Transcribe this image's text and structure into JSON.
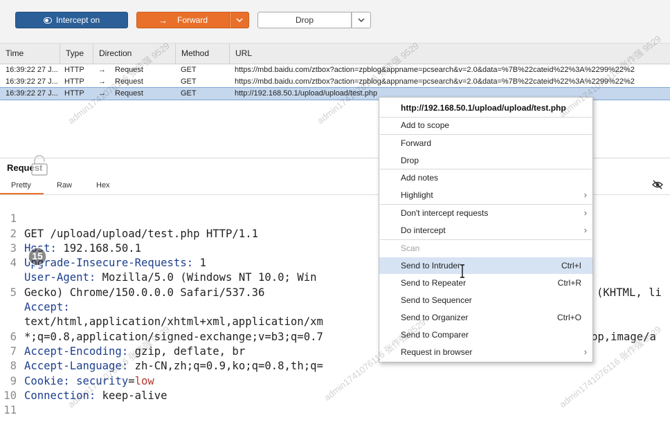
{
  "toolbar": {
    "intercept_label": "Intercept on",
    "forward_label": "Forward",
    "drop_label": "Drop"
  },
  "table": {
    "columns": [
      "Time",
      "Type",
      "Direction",
      "Method",
      "URL"
    ],
    "rows": [
      {
        "time": "16:39:22 27 J...",
        "type": "HTTP",
        "direction": "Request",
        "method": "GET",
        "url": "https://mbd.baidu.com/ztbox?action=zpblog&appname=pcsearch&v=2.0&data=%7B%22cateid%22%3A%2299%22%2"
      },
      {
        "time": "16:39:22 27 J...",
        "type": "HTTP",
        "direction": "Request",
        "method": "GET",
        "url": "https://mbd.baidu.com/ztbox?action=zpblog&appname=pcsearch&v=2.0&data=%7B%22cateid%22%3A%2299%22%2"
      },
      {
        "time": "16:39:22 27 J...",
        "type": "HTTP",
        "direction": "Request",
        "method": "GET",
        "url": "http://192.168.50.1/upload/upload/test.php"
      }
    ]
  },
  "request_panel": {
    "title": "Request",
    "tabs": [
      "Pretty",
      "Raw",
      "Hex"
    ],
    "lines": [
      {
        "n": "1",
        "key": "",
        "val": "GET /upload/upload/test.php HTTP/1.1"
      },
      {
        "n": "2",
        "key": "Host:",
        "val": " 192.168.50.1"
      },
      {
        "n": "3",
        "key": "Upgrade-Insecure-Requests:",
        "val": " 1"
      },
      {
        "n": "4",
        "key": "User-Agent:",
        "val": " Mozilla/5.0 (Windows NT 10.0; Win"
      },
      {
        "n": "",
        "key": "",
        "val": "Gecko) Chrome/150.0.0.0 Safari/537.36"
      },
      {
        "n": "5",
        "key": "Accept:",
        "val": ""
      },
      {
        "n": "",
        "key": "",
        "val": "text/html,application/xhtml+xml,application/xm"
      },
      {
        "n": "",
        "key": "",
        "val": "*;q=0.8,application/signed-exchange;v=b3;q=0.7"
      },
      {
        "n": "6",
        "key": "Accept-Encoding:",
        "val": " gzip, deflate, br"
      },
      {
        "n": "7",
        "key": "Accept-Language:",
        "val": " zh-CN,zh;q=0.9,ko;q=0.8,th;q="
      },
      {
        "n": "8",
        "key": "Cookie:",
        "val": ""
      },
      {
        "n": "9",
        "key": "Connection:",
        "val": " keep-alive"
      },
      {
        "n": "10",
        "key": "",
        "val": ""
      },
      {
        "n": "11",
        "key": "",
        "val": ""
      }
    ],
    "cookie_name": "security",
    "cookie_eq": "=",
    "cookie_value": "low",
    "ua_tail": "(KHTML, li",
    "accept_tail": "bp,image/a"
  },
  "context_menu": {
    "url": "http://192.168.50.1/upload/upload/test.php",
    "items": [
      {
        "label": "Add to scope",
        "shortcut": ""
      },
      {
        "label": "Forward",
        "shortcut": ""
      },
      {
        "label": "Drop",
        "shortcut": ""
      },
      {
        "label": "Add notes",
        "shortcut": ""
      },
      {
        "label": "Highlight",
        "shortcut": ""
      },
      {
        "label": "Don't intercept requests",
        "shortcut": ""
      },
      {
        "label": "Do intercept",
        "shortcut": ""
      },
      {
        "label": "Scan",
        "shortcut": ""
      },
      {
        "label": "Send to Intruder",
        "shortcut": "Ctrl+I"
      },
      {
        "label": "Send to Repeater",
        "shortcut": "Ctrl+R"
      },
      {
        "label": "Send to Sequencer",
        "shortcut": ""
      },
      {
        "label": "Send to Organizer",
        "shortcut": "Ctrl+O"
      },
      {
        "label": "Send to Comparer",
        "shortcut": ""
      },
      {
        "label": "Request in browser",
        "shortcut": ""
      }
    ]
  },
  "overlay": {
    "timer_value": "15",
    "watermark": "admin1741076116 张作强 9529"
  },
  "colors": {
    "intercept_blue": "#2c5f97",
    "forward_orange": "#e8702a",
    "selected_row": "#c5d7ec",
    "menu_highlight": "#d6e3f3"
  }
}
